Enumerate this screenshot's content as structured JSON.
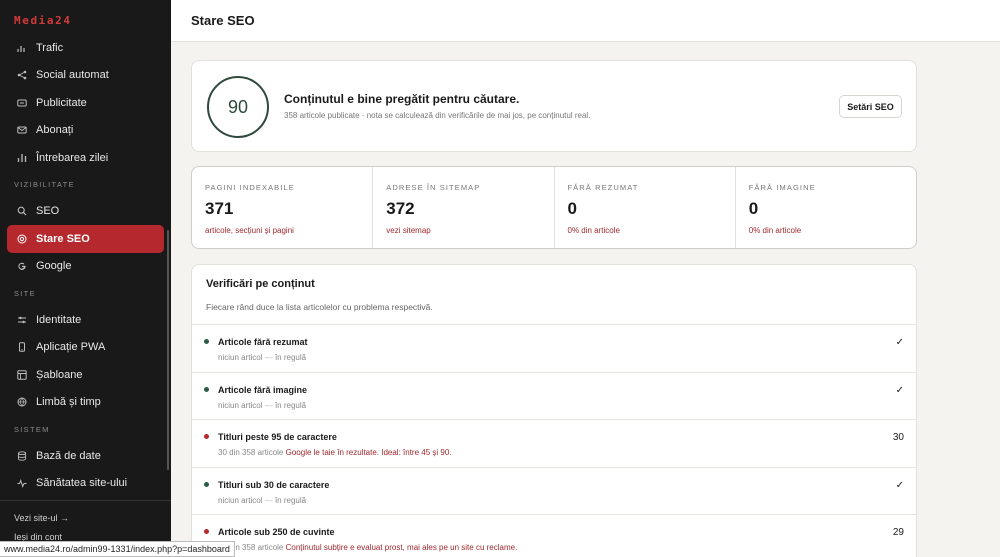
{
  "brand": "Media24",
  "sidebar": {
    "items_top": [
      {
        "label": "Trafic",
        "icon": "chart-icon"
      },
      {
        "label": "Social automat",
        "icon": "share-icon"
      },
      {
        "label": "Publicitate",
        "icon": "ad-icon"
      },
      {
        "label": "Abonați",
        "icon": "mail-icon"
      },
      {
        "label": "Întrebarea zilei",
        "icon": "bar-chart-icon"
      }
    ],
    "section_vizibilitate": "VIZIBILITATE",
    "items_viz": [
      {
        "label": "SEO",
        "icon": "search-icon"
      },
      {
        "label": "Stare SEO",
        "icon": "target-icon",
        "active": true
      },
      {
        "label": "Google",
        "icon": "google-icon"
      }
    ],
    "section_site": "SITE",
    "items_site": [
      {
        "label": "Identitate",
        "icon": "sliders-icon"
      },
      {
        "label": "Aplicație PWA",
        "icon": "phone-icon"
      },
      {
        "label": "Șabloane",
        "icon": "template-icon"
      },
      {
        "label": "Limbă și timp",
        "icon": "globe-icon"
      }
    ],
    "section_sistem": "SISTEM",
    "items_sistem": [
      {
        "label": "Bază de date",
        "icon": "database-icon"
      },
      {
        "label": "Sănătatea site-ului",
        "icon": "pulse-icon"
      }
    ],
    "footer": {
      "view_site": "Vezi site-ul →",
      "logout": "Ieși din cont"
    },
    "accent": "#b5282e"
  },
  "status_bar": "www.media24.ro/admin99-1331/index.php?p=dashboard",
  "page": {
    "title": "Stare SEO"
  },
  "hero": {
    "score": "90",
    "title": "Conținutul e bine pregătit pentru căutare.",
    "subtitle": "358 articole publicate · nota se calculează din verificările de mai jos, pe conținutul real.",
    "button": "Setări SEO"
  },
  "stats": [
    {
      "label": "PAGINI INDEXABILE",
      "value": "371",
      "link": "articole, secțiuni și pagini"
    },
    {
      "label": "ADRESE ÎN SITEMAP",
      "value": "372",
      "link": "vezi sitemap"
    },
    {
      "label": "FĂRĂ REZUMAT",
      "value": "0",
      "link": "0% din articole"
    },
    {
      "label": "FĂRĂ IMAGINE",
      "value": "0",
      "link": "0% din articole"
    }
  ],
  "checks": {
    "title": "Verificări pe conținut",
    "description": "Fiecare rând duce la lista articolelor cu problema respectivă.",
    "rows": [
      {
        "status": "ok",
        "title": "Articole fără rezumat",
        "sub_a": "niciun articol",
        "sep": "—",
        "sub_b": "în regulă",
        "value": "✓"
      },
      {
        "status": "ok",
        "title": "Articole fără imagine",
        "sub_a": "niciun articol",
        "sep": "—",
        "sub_b": "în regulă",
        "value": "✓"
      },
      {
        "status": "bad",
        "title": "Titluri peste 95 de caractere",
        "sub_a": "30 din 358 articole",
        "sep": "",
        "sub_b": "Google le taie în rezultate. Ideal: între 45 și 90.",
        "value": "30"
      },
      {
        "status": "ok",
        "title": "Titluri sub 30 de caractere",
        "sub_a": "niciun articol",
        "sep": "—",
        "sub_b": "în regulă",
        "value": "✓"
      },
      {
        "status": "bad",
        "title": "Articole sub 250 de cuvinte",
        "sub_a": "29 din 358 articole",
        "sep": "",
        "sub_b": "Conținutul subțire e evaluat prost, mai ales pe un site cu reclame.",
        "value": "29"
      }
    ]
  }
}
